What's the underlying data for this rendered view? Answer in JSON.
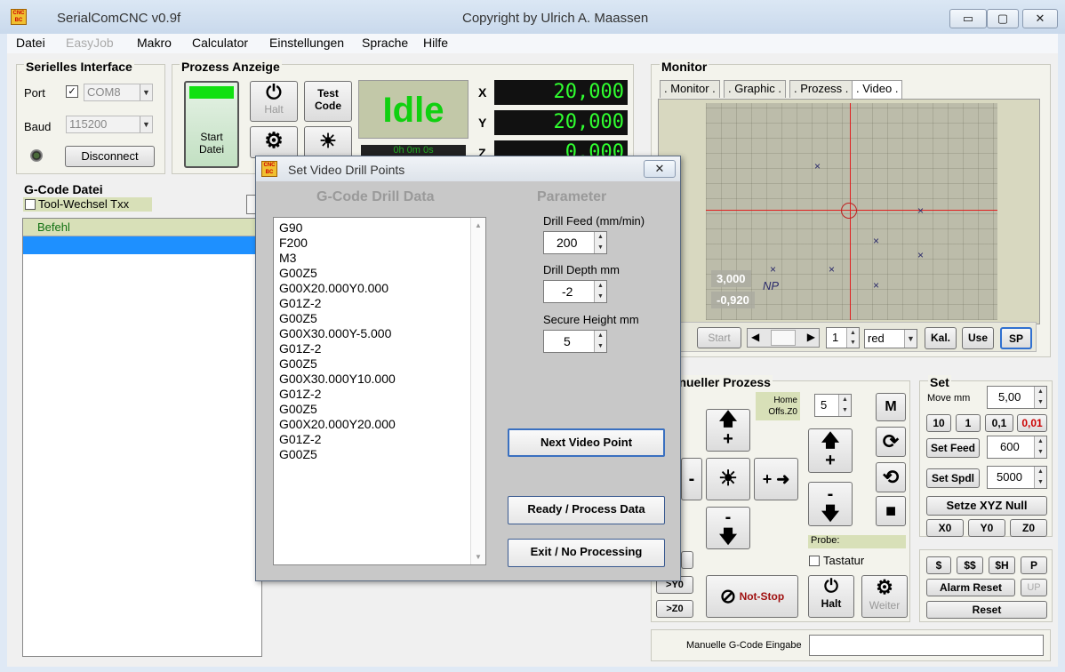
{
  "window": {
    "title": "SerialComCNC  v0.9f",
    "copyright": "Copyright by Ulrich A. Maassen",
    "controls": [
      "▭",
      "▢",
      "✕"
    ],
    "icon_text": "CNC BC"
  },
  "menu": [
    "Datei",
    "EasyJob",
    "Makro",
    "Calculator",
    "Einstellungen",
    "Sprache",
    "Hilfe"
  ],
  "serial": {
    "header": "Serielles Interface",
    "port_label": "Port",
    "port_value": "COM8",
    "baud_label": "Baud",
    "baud_value": "115200",
    "disconnect": "Disconnect"
  },
  "process": {
    "header": "Prozess Anzeige",
    "start": "Start",
    "start2": "Datei",
    "halt": "Halt",
    "test1": "Test",
    "test2": "Code",
    "status": "Idle",
    "time": "0h 0m 0s",
    "x_label": "X",
    "x_value": "20,000",
    "y_label": "Y",
    "y_value": "20,000",
    "z_label": "Z",
    "z_value": "0,000"
  },
  "gcode": {
    "header": "G-Code Datei",
    "tool_change": "Tool-Wechsel Txx",
    "col_header": "Befehl"
  },
  "monitor": {
    "header": "Monitor",
    "tabs": [
      ". Monitor .",
      ". Graphic .",
      ". Prozess .",
      ". Video ."
    ],
    "coord1": "3,000",
    "coord2": "-0,920",
    "np": "NP",
    "start": "Start",
    "count": "1",
    "color": "red",
    "kal": "Kal.",
    "use": "Use",
    "sp": "SP"
  },
  "manual": {
    "header": "Manueller Prozess",
    "home": "Home",
    "offs": "Offs.Z0",
    "step": "5",
    "m": "M",
    "minus": "-",
    "plus_arrow": "+ ➜",
    "plus": "+",
    "probe": "Probe:",
    "tastatur": "Tastatur",
    "y0": ">Y0",
    "z0": ">Z0",
    "notstop": "Not-Stop",
    "halt": "Halt",
    "weiter": "Weiter",
    "gcode_input_label": "Manuelle G-Code Eingabe"
  },
  "set": {
    "header": "Set",
    "move_label": "Move mm",
    "move_value": "5,00",
    "steps": [
      "10",
      "1",
      "0,1",
      "0,01"
    ],
    "feed_btn": "Set Feed",
    "feed_value": "600",
    "spdl_btn": "Set Spdl",
    "spdl_value": "5000",
    "null_btn": "Setze XYZ Null",
    "axes": [
      "X0",
      "Y0",
      "Z0"
    ],
    "macros": [
      "$",
      "$$",
      "$H",
      "P"
    ],
    "alarm": "Alarm Reset",
    "up": "UP",
    "reset": "Reset"
  },
  "dialog": {
    "title": "Set Video Drill Points",
    "close": "✕",
    "data_header": "G-Code Drill Data",
    "param_header": "Parameter",
    "lines": [
      "G90",
      "F200",
      "M3",
      "G00Z5",
      "G00X20.000Y0.000",
      "G01Z-2",
      "G00Z5",
      "G00X30.000Y-5.000",
      "G01Z-2",
      "G00Z5",
      "G00X30.000Y10.000",
      "G01Z-2",
      "G00Z5",
      "G00X20.000Y20.000",
      "G01Z-2",
      "G00Z5"
    ],
    "feed_label": "Drill Feed (mm/min)",
    "feed_value": "200",
    "depth_label": "Drill Depth mm",
    "depth_value": "-2",
    "height_label": "Secure Height mm",
    "height_value": "5",
    "next": "Next Video Point",
    "ready": "Ready / Process Data",
    "exit": "Exit / No Processing"
  }
}
